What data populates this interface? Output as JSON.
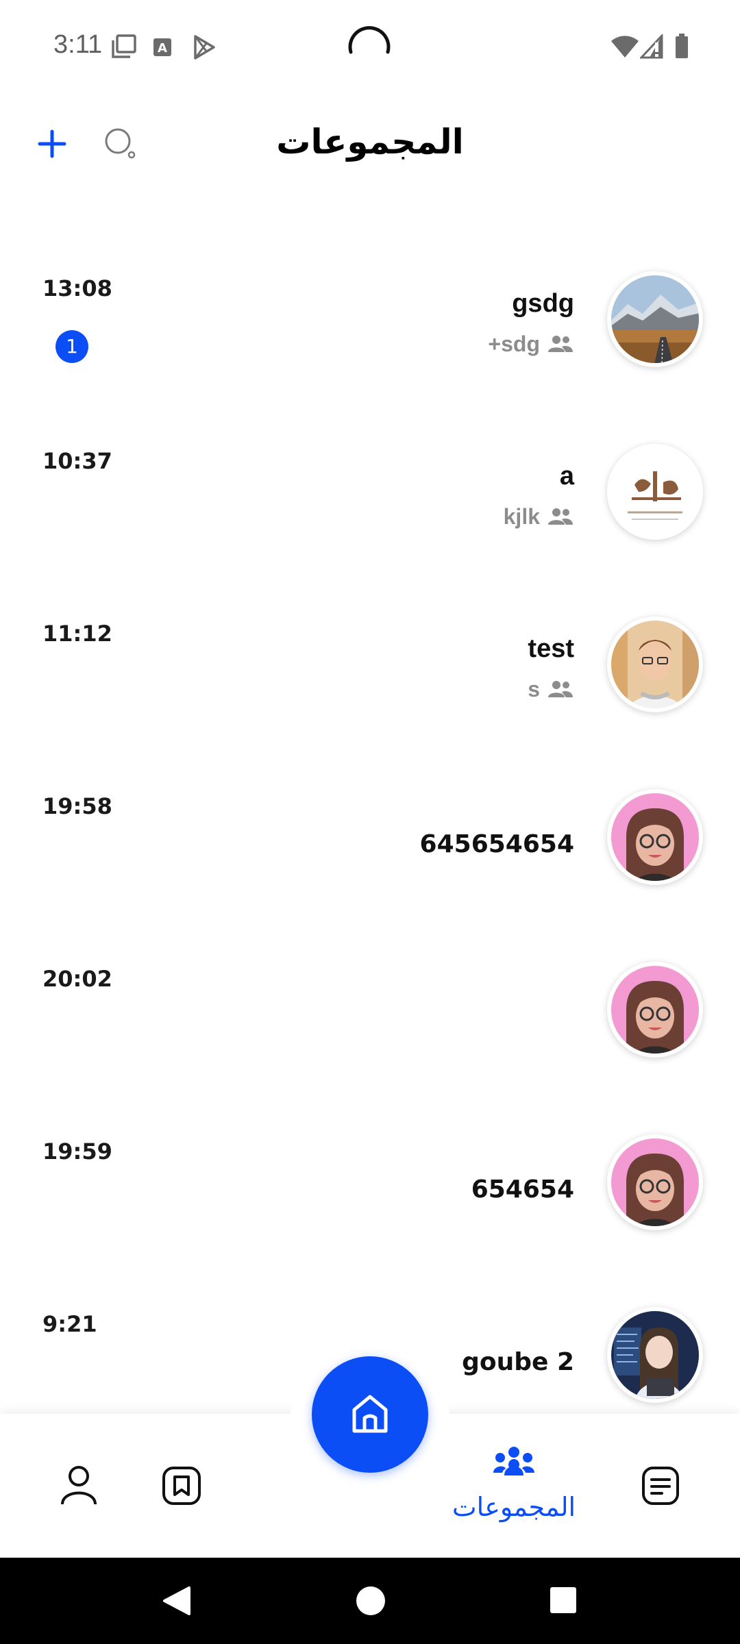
{
  "status_bar": {
    "time": "3:11",
    "icons": [
      "screenshot-icon",
      "font-icon",
      "play-store-icon",
      "wifi-icon",
      "cellular-icon",
      "battery-icon"
    ]
  },
  "header": {
    "title": "المجموعات",
    "add_icon": "plus-icon",
    "search_icon": "search-icon",
    "accent_color": "#0b4ef5"
  },
  "groups": [
    {
      "name": "gsdg",
      "last_message": "+sdg",
      "time": "13:08",
      "unread": "1",
      "avatar": "landscape"
    },
    {
      "name": "a",
      "last_message": "kjlk",
      "time": "10:37",
      "unread": "",
      "avatar": "logo"
    },
    {
      "name": "test",
      "last_message": "s",
      "time": "11:12",
      "unread": "",
      "avatar": "man-photo"
    },
    {
      "name": "645654654",
      "last_message": "",
      "time": "19:58",
      "unread": "",
      "avatar": "cartoon-girl"
    },
    {
      "name": "",
      "last_message": "",
      "time": "20:02",
      "unread": "",
      "avatar": "cartoon-girl"
    },
    {
      "name": "654654",
      "last_message": "",
      "time": "19:59",
      "unread": "",
      "avatar": "cartoon-girl"
    },
    {
      "name": "goube 2",
      "last_message": "",
      "time": "9:21",
      "unread": "",
      "avatar": "anime-girl"
    }
  ],
  "bottom_nav": {
    "active_label": "المجموعات",
    "items": [
      "profile-icon",
      "bookmark-icon",
      "home-icon",
      "groups-icon",
      "notes-icon"
    ]
  },
  "system_nav": {
    "buttons": [
      "back-icon",
      "home-circle-icon",
      "recents-icon"
    ]
  }
}
